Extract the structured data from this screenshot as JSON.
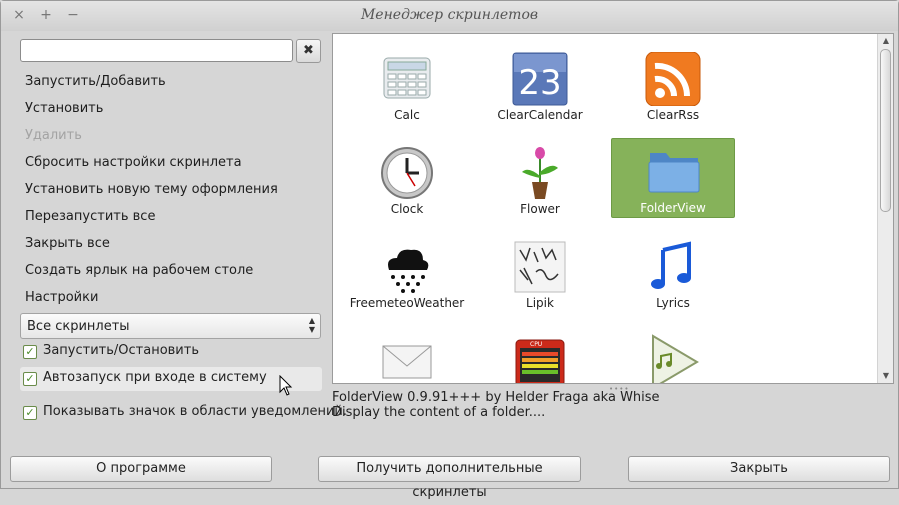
{
  "window": {
    "title": "Менеджер скринлетов",
    "close_glyph": "×",
    "maximize_glyph": "+",
    "minimize_glyph": "−"
  },
  "search": {
    "value": "",
    "placeholder": "",
    "clear_icon": "✖"
  },
  "actions": [
    {
      "label": "Запустить/Добавить",
      "enabled": true
    },
    {
      "label": "Установить",
      "enabled": true
    },
    {
      "label": "Удалить",
      "enabled": false
    },
    {
      "label": "Сбросить настройки скринлета",
      "enabled": true
    },
    {
      "label": "Установить новую тему оформления",
      "enabled": true
    },
    {
      "label": "Перезапустить все",
      "enabled": true
    },
    {
      "label": "Закрыть все",
      "enabled": true
    },
    {
      "label": "Создать ярлык на рабочем столе",
      "enabled": true
    },
    {
      "label": "Настройки",
      "enabled": true
    }
  ],
  "filter": {
    "selected": "Все скринлеты"
  },
  "checks": [
    {
      "label": "Запустить/Остановить",
      "checked": true
    },
    {
      "label": "Автозапуск при входе в систему",
      "checked": true
    },
    {
      "label": "Показывать значок в области уведомлений.",
      "checked": true
    }
  ],
  "screenlets": [
    {
      "name": "Calc",
      "icon": "calculator-icon"
    },
    {
      "name": "ClearCalendar",
      "icon": "calendar-icon",
      "date": "23"
    },
    {
      "name": "ClearRss",
      "icon": "rss-icon"
    },
    {
      "name": "Clock",
      "icon": "clock-icon"
    },
    {
      "name": "Flower",
      "icon": "flower-icon"
    },
    {
      "name": "FolderView",
      "icon": "folder-icon",
      "selected": true
    },
    {
      "name": "FreemeteoWeather",
      "icon": "weather-cloud-icon"
    },
    {
      "name": "Lipik",
      "icon": "sketch-note-icon"
    },
    {
      "name": "Lyrics",
      "icon": "music-note-icon"
    },
    {
      "name": "",
      "icon": "envelope-icon"
    },
    {
      "name": "",
      "icon": "cpu-meter-icon",
      "badge": "CPU"
    },
    {
      "name": "",
      "icon": "play-music-icon"
    }
  ],
  "info": {
    "line1": "FolderView 0.9.91+++ by Helder Fraga aka Whise",
    "line2": "Display the content of a folder...."
  },
  "buttons": {
    "about": "О программе",
    "get_more": "Получить дополнительные скринлеты",
    "close": "Закрыть"
  },
  "colors": {
    "selection": "#86b25a",
    "check": "#4a8a2a",
    "background": "#d6d6d6"
  }
}
